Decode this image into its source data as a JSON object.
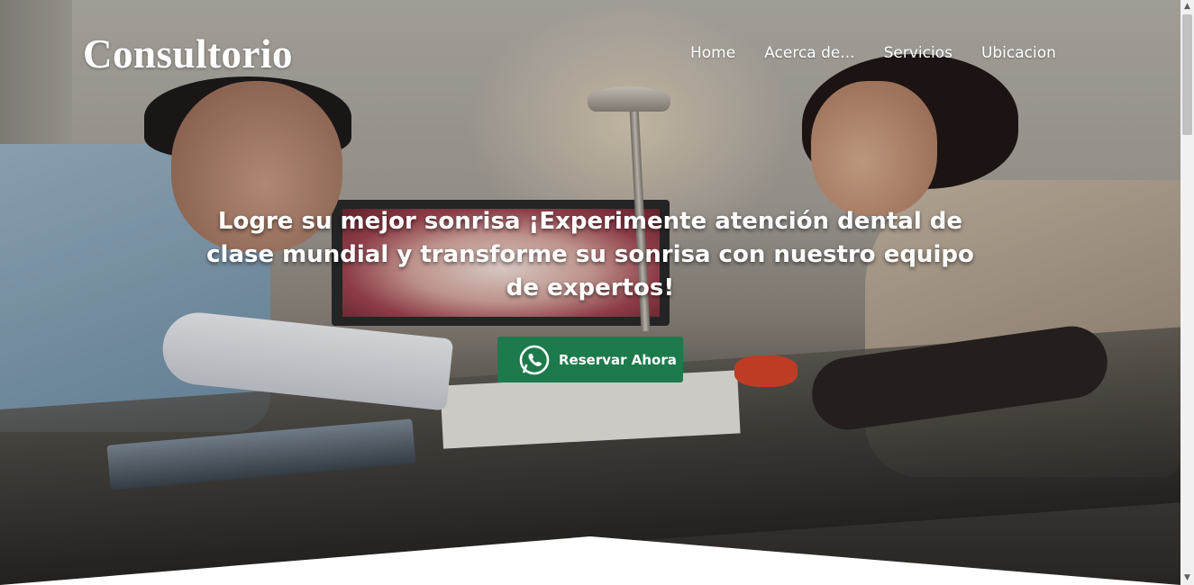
{
  "brand": {
    "title": "Consultorio"
  },
  "nav": {
    "items": [
      {
        "label": "Home"
      },
      {
        "label": "Acerca de..."
      },
      {
        "label": "Servicios"
      },
      {
        "label": "Ubicacion"
      }
    ]
  },
  "hero": {
    "headline": "Logre su mejor sonrisa ¡Experimente atención dental de clase mundial y transforme su sonrisa con nuestro equipo de expertos!",
    "cta_label": "Reservar Ahora",
    "cta_icon": "whatsapp-icon"
  },
  "colors": {
    "cta_background": "#1d7a4c",
    "text": "#ffffff"
  },
  "scrollbar": {
    "up_glyph": "▲",
    "down_glyph": "▼"
  }
}
